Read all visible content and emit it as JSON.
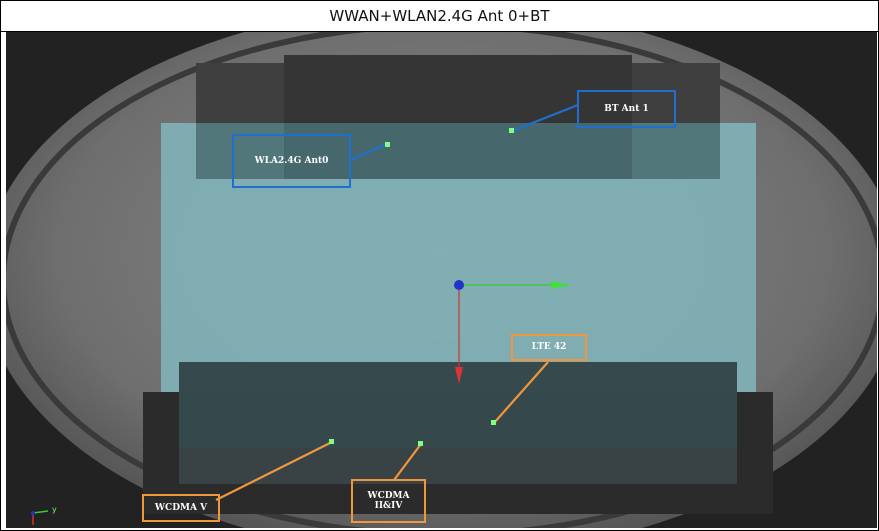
{
  "window": {
    "title": "WWAN+WLAN2.4G Ant 0+BT"
  },
  "callouts": {
    "bt_ant1": "BT Ant 1",
    "wlan_ant0": "WLA2.4G Ant0",
    "lte42": "LTE 42",
    "wcdma_v": "WCDMA V",
    "wcdma_2_4": "WCDMA II&IV"
  },
  "triad": {
    "y_label": "y"
  },
  "colors": {
    "callout_blue": "#1e6fd0",
    "callout_orange": "#f0963c",
    "feed_point": "#7fff7f",
    "board": "#7fb2b8",
    "x_axis": "#33cc33",
    "z_axis": "#cc3333",
    "origin": "#2233cc"
  },
  "icons": [
    "origin-sphere-icon",
    "green-axis-arrow-icon",
    "red-axis-arrow-icon",
    "triad-icon"
  ]
}
